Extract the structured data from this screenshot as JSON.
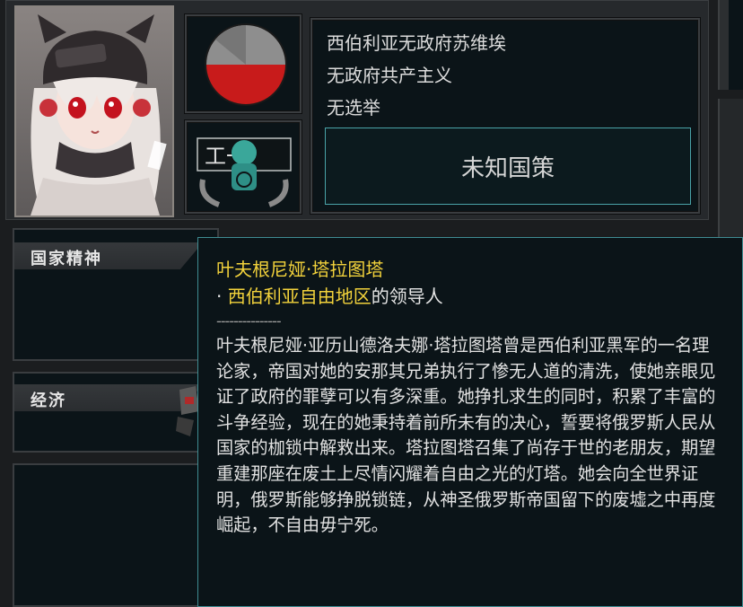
{
  "country": {
    "name": "西伯利亚无政府苏维埃",
    "ideology": "无政府共产主义",
    "election": "无选举",
    "policy_button": "未知国策"
  },
  "ideology_pie": {
    "slices": [
      {
        "label": "red",
        "fraction": 0.5,
        "color": "#c81b1b"
      },
      {
        "label": "gray",
        "fraction": 0.5,
        "color": "#8e8e8e"
      }
    ]
  },
  "ideology_emblem_text": "工一",
  "sections": {
    "national_spirit": "国家精神",
    "economy": "经济"
  },
  "tooltip": {
    "leader_name": "叶夫根尼娅·塔拉图塔",
    "role_prefix": "· ",
    "region": "西伯利亚自由地区",
    "role_suffix": "的领导人",
    "separator": "---------------",
    "bio": "叶夫根尼娅·亚历山德洛夫娜·塔拉图塔曾是西伯利亚黑军的一名理论家，帝国对她的安那其兄弟执行了惨无人道的清洗，使她亲眼见证了政府的罪孽可以有多深重。她挣扎求生的同时，积累了丰富的斗争经验，现在的她秉持着前所未有的决心，誓要将俄罗斯人民从国家的枷锁中解救出来。塔拉图塔召集了尚存于世的老朋友，期望重建那座在废土上尽情闪耀着自由之光的灯塔。她会向全世界证明，俄罗斯能够挣脱锁链，从神圣俄罗斯帝国留下的废墟之中再度崛起，不自由毋宁死。"
  },
  "colors": {
    "tooltip_highlight": "#f2d23b",
    "panel_bg": "#0b1418",
    "accent_border": "#4aa3a8"
  }
}
